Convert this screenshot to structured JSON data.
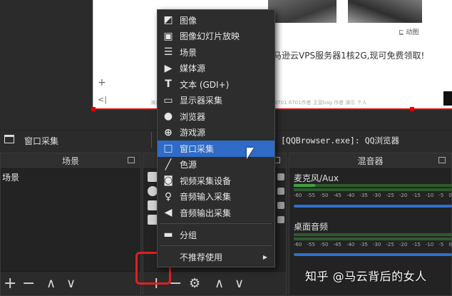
{
  "preview": {
    "caption_small": "⊑ 动图",
    "article_title": "亚马逊云VPS服务器1核2G,现可免费领取!",
    "url_line": "演示小说 6690110000000000009子穴 网站 微信 wb9701 6701作者 主营bag 作者 演示 个人",
    "plus": "+",
    "back": "<|"
  },
  "source_bar": {
    "name": "窗口采集",
    "target": "[QQBrowser.exe]: QQ浏览器"
  },
  "docks": {
    "scenes": {
      "title": "场景",
      "items": [
        "场景"
      ]
    },
    "sources": {
      "title": ""
    },
    "mixer": {
      "title": "混音器",
      "channels": [
        {
          "name": "麦克风/Aux"
        },
        {
          "name": "桌面音频"
        }
      ],
      "scale": [
        "-60",
        "-55",
        "-50",
        "-45",
        "-40",
        "-35",
        "-30",
        "-25",
        "-20",
        "-15",
        "-10",
        "-5",
        "0"
      ]
    }
  },
  "footer": {
    "add": "+",
    "remove": "−",
    "up": "∧",
    "down": "∨",
    "gear": "⚙"
  },
  "context_menu": {
    "items": [
      {
        "label": "图像",
        "icon": "image-icon"
      },
      {
        "label": "图像幻灯片放映",
        "icon": "slideshow-icon"
      },
      {
        "label": "场景",
        "icon": "list-icon"
      },
      {
        "label": "媒体源",
        "icon": "play-icon"
      },
      {
        "label": "文本 (GDI+)",
        "icon": "text-icon"
      },
      {
        "label": "显示器采集",
        "icon": "monitor-icon"
      },
      {
        "label": "浏览器",
        "icon": "globe-icon"
      },
      {
        "label": "游戏源",
        "icon": "gamepad-icon"
      },
      {
        "label": "窗口采集",
        "icon": "window-icon",
        "active": true
      },
      {
        "label": "色源",
        "icon": "brush-icon"
      },
      {
        "label": "视频采集设备",
        "icon": "camera-icon"
      },
      {
        "label": "音频输入采集",
        "icon": "microphone-icon"
      },
      {
        "label": "音频输出采集",
        "icon": "speaker-icon"
      },
      {
        "label": "分组",
        "icon": "folder-icon"
      },
      {
        "label": "不推荐使用",
        "icon": "",
        "submenu": true
      }
    ]
  },
  "watermark": "知乎 @马云背后的女人",
  "colors": {
    "accent": "#2f6bc7",
    "highlight_box": "#e02020",
    "meter": "#3f9e3f",
    "slider": "#2d6fd1"
  }
}
